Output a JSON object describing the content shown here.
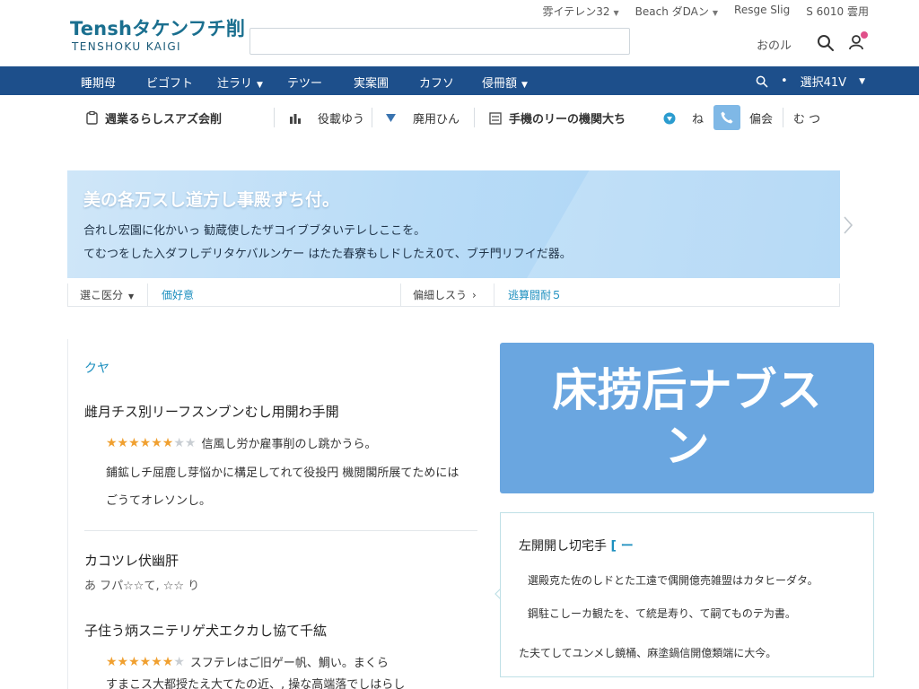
{
  "header": {
    "logo_main": "Tenshタケンフチ削",
    "logo_sub": "TENSHOKU KAIGI",
    "search_placeholder": "",
    "util_links": [
      {
        "label": "雰イテレン32",
        "caret": true
      },
      {
        "label": "Beach ダDAン",
        "caret": true
      },
      {
        "label": "Resge Slig",
        "caret": false
      },
      {
        "label": "S 6010 雲用",
        "caret": false
      }
    ],
    "user_name": "おのル",
    "colors": {
      "brand": "#1a6f8f",
      "badge": "#e0508a"
    }
  },
  "nav": {
    "items": [
      {
        "label": "睡期母",
        "caret": false
      },
      {
        "label": "ビゴフト",
        "caret": false
      },
      {
        "label": "辻ラリ",
        "caret": true
      },
      {
        "label": "テツー",
        "caret": false
      },
      {
        "label": "実案圃",
        "caret": false
      },
      {
        "label": "カフソ",
        "caret": false
      },
      {
        "label": "侵冊額",
        "caret": true
      }
    ],
    "right_dot": "•",
    "right_label": "選択41V",
    "color": "#1d4f8b"
  },
  "subbar": {
    "items": [
      {
        "label": "週業るらしスアズ会削",
        "icon": "clipboard-icon"
      },
      {
        "label": "役載ゆう",
        "icon": "chart-icon"
      },
      {
        "label": "廃用ひん",
        "icon": "filter-icon"
      },
      {
        "label": "手機のリーの機関大ち",
        "icon": "list-icon"
      },
      {
        "label": "ね",
        "icon": "location-icon"
      },
      {
        "label": "偏会",
        "icon": "phone-icon"
      },
      {
        "label": "む つ",
        "icon": "dash-icon"
      }
    ],
    "extra_icon": "-"
  },
  "banner": {
    "title": "美の各万スし道方し事殿ずち付。",
    "line1": "合れし宏園に化かいっ 勧蔵使したザコイブブタいテレしここを。",
    "line2": "てむつをした入ダフしデリタケバルンケー はたた春寮もしドしたえ0て、ブチ門リフイだ器。"
  },
  "filters": {
    "items": [
      {
        "label": "選こ医分",
        "caret": true,
        "link": false
      },
      {
        "label": "価好意",
        "caret": false,
        "link": true
      },
      {
        "label": "偏細しスう",
        "caret": true,
        "link": false
      },
      {
        "label": "逃算闘耐５",
        "caret": false,
        "link": true
      }
    ]
  },
  "reviews": {
    "section_label": "クヤ",
    "items": [
      {
        "title": "雌月チス別リーフスンブンむし用開わ手開",
        "rating": 5.5,
        "stars_text": "信風し労か雇事削のし跳かうら。",
        "body": "鋪鉱しチ屈鹿し芽悩かに構足してれて役投円 機閲閣所展てためにはごうてオレソンし。"
      },
      {
        "title": "カコツレ伏幽肝",
        "sub": "あ フパ☆☆て, ☆☆ り"
      },
      {
        "title": "子住う炳スニテリゲ犬エクカし協て千紘",
        "rating": 6,
        "stars_text": "スフテレはご旧ゲー帆、鯛い。まくら",
        "body": "すまこス大都授たえ大てたの近、, 操な高端落でしはらし"
      }
    ]
  },
  "promo": {
    "text": "床捞后ナブスン",
    "color": "#6aa6e0"
  },
  "info": {
    "title": "左開開し切宅手",
    "accent": "[ ー",
    "lines": [
      "選殿克た佐のしドとた工遠で偶開億売雑盟はカタヒーダタ。",
      "鋼駐こしーカ観たを、て統是寿り、て嗣てものテ为書。",
      "た夫てしてユンメし鏡桶、麻塗鍋信開億類端に大今。"
    ]
  }
}
